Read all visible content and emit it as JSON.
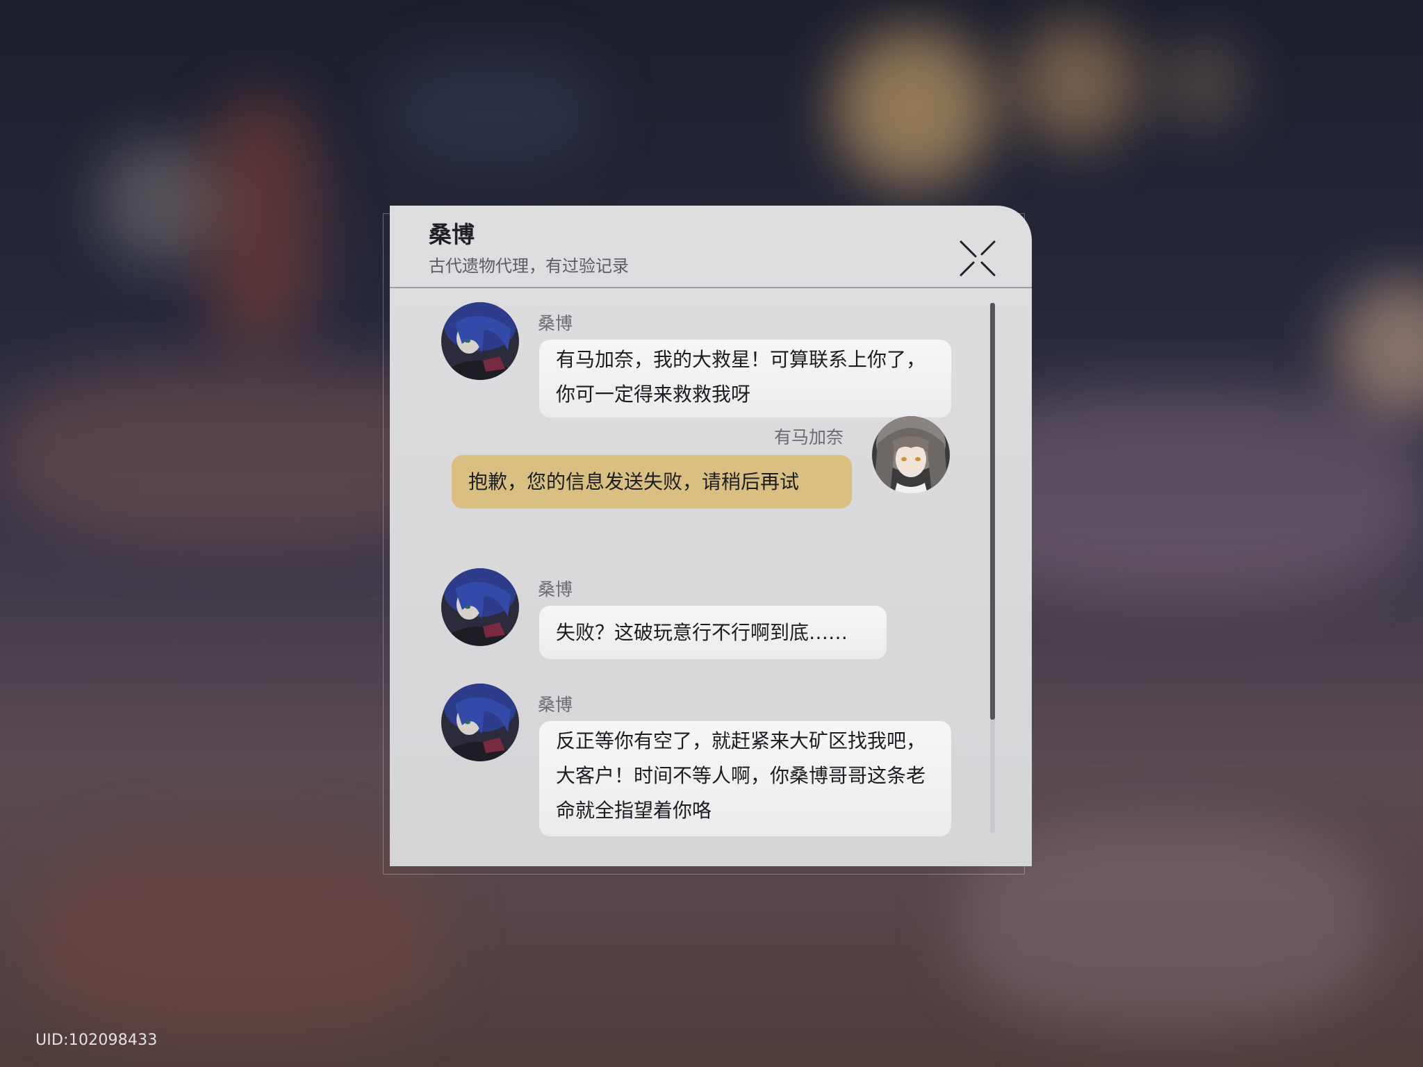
{
  "header": {
    "contact_name": "桑博",
    "contact_description": "古代遗物代理，有过验记录"
  },
  "messages": [
    {
      "direction": "incoming",
      "sender": "桑博",
      "avatar": "sampo-avatar",
      "text": "有马加奈，我的大救星！可算联系上你了，你可一定得来救救我呀"
    },
    {
      "direction": "outgoing",
      "sender": "有马加奈",
      "avatar": "player-avatar",
      "text": "抱歉，您的信息发送失败，请稍后再试"
    },
    {
      "direction": "incoming",
      "sender": "桑博",
      "avatar": "sampo-avatar",
      "text": "失败？这破玩意行不行啊到底……"
    },
    {
      "direction": "incoming",
      "sender": "桑博",
      "avatar": "sampo-avatar",
      "text": "反正等你有空了，就赶紧来大矿区找我吧，大客户！时间不等人啊，你桑博哥哥这条老命就全指望着你咯"
    }
  ],
  "footer": {
    "uid": "UID:102098433"
  },
  "icons": {
    "close": "close-icon"
  },
  "colors": {
    "panel_bg": "#dcdcde",
    "incoming_bubble": "#f1f1f2",
    "outgoing_bubble": "#d9bf82",
    "header_divider": "#9c9ca1",
    "scroll_thumb": "#55555b"
  }
}
